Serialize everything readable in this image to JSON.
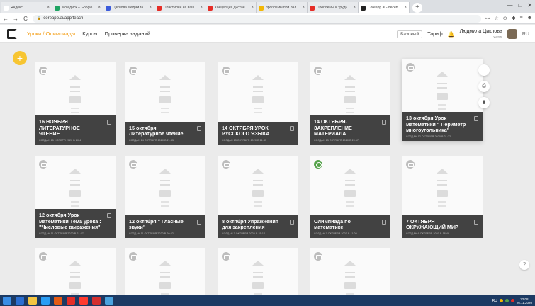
{
  "browser": {
    "tabs": [
      {
        "title": "Яндекс",
        "color": "#ffffff"
      },
      {
        "title": "Мой диск – Google Диск",
        "color": "#1fa463"
      },
      {
        "title": "Циклова Людмила Алекс",
        "color": "#3b5bdb"
      },
      {
        "title": "Пластилин на ваши – Yo",
        "color": "#e52d27"
      },
      {
        "title": "Концепция дистанционн",
        "color": "#e52d27"
      },
      {
        "title": "проблемы при онлайн об",
        "color": "#f2b705"
      },
      {
        "title": "Проблемы и трудности д",
        "color": "#e52d27"
      },
      {
        "title": "Coreapp.ai - decentralized",
        "color": "#222222"
      }
    ],
    "active_tab": 7,
    "new_tab": "+",
    "window_controls": [
      "—",
      "□",
      "✕"
    ],
    "nav": {
      "back": "←",
      "forward": "→",
      "reload": "C",
      "lock": "🔒"
    },
    "url": "coreapp.ai/app/teach",
    "toolbar_icons": [
      "⊶",
      "☆",
      "⊙",
      "✱",
      "≡",
      "☻"
    ]
  },
  "app": {
    "breadcrumb": {
      "part1": "Уроки",
      "sep": "/",
      "part2": "Олимпиады"
    },
    "menu": [
      "Курсы",
      "Проверка заданий"
    ],
    "plan_badge": "Базовый",
    "tariff_link": "Тариф",
    "bell": "🔔",
    "user": {
      "name": "Людмила Циклова",
      "role": "ученик"
    },
    "lang": "RU",
    "add_button": "+"
  },
  "cards": [
    {
      "title": "16 НОЯБРЯ ЛИТЕРАТУРНОЕ ЧТЕНИЕ",
      "date": "СОЗДАН 15 НОЯБРЯ 2020 В 20:4"
    },
    {
      "title": "15 октября Литературное чтение",
      "date": "СОЗДАН 14 ОКТЯБРЯ 2020 В 21:35"
    },
    {
      "title": "14 ОКТЯБРЯ УРОК РУССКОГО ЯЗЫКА",
      "date": "СОЗДАН 13 ОКТЯБРЯ 2020 В 21:33"
    },
    {
      "title": "14 ОКТЯБРЯ. ЗАКРЕПЛЕНИЕ МАТЕРИАЛА.",
      "date": "СОЗДАН 13 ОКТЯБРЯ 2020 В 20:17"
    },
    {
      "title": "13 октября Урок математики \" Периметр многоугольника\"",
      "date": "СОЗДАН 12 ОКТЯБРЯ 2020 В 21:22"
    },
    {
      "title": "12 октября Урок математики Тема урока : \"Числовые выражения\"",
      "date": "СОЗДАН 11 ОКТЯБРЯ 2020 В 21:27"
    },
    {
      "title": "12 октября \" Гласные звуки\"",
      "date": "СОЗДАН 11 ОКТЯБРЯ 2020 В 20:32"
    },
    {
      "title": "8 октября Упражнения для закрепления",
      "date": "СОЗДАН 7 ОКТЯБРЯ 2020 В 21:14"
    },
    {
      "title": "Олимпиада по математике",
      "date": "СОЗДАН 7 ОКТЯБРЯ 2020 В 11:00"
    },
    {
      "title": "7 ОКТЯБРЯ ОКРУЖАЮЩИЙ МИР",
      "date": "СОЗДАН 6 ОКТЯБРЯ 2020 В 18:48"
    },
    {
      "title": "",
      "date": ""
    },
    {
      "title": "",
      "date": ""
    },
    {
      "title": "",
      "date": ""
    },
    {
      "title": "",
      "date": ""
    }
  ],
  "side_actions": [
    "⋯",
    "⎙",
    "▮"
  ],
  "help": "?",
  "taskbar": {
    "apps": [
      "#2b6ed1",
      "#f4c542",
      "#2a9df4",
      "#e55b13",
      "#e52d27",
      "#ff3b30",
      "#d32f2f",
      "#4aa3df"
    ],
    "tray_lang": "RU",
    "time": "22:08",
    "date": "26.11.2020"
  }
}
